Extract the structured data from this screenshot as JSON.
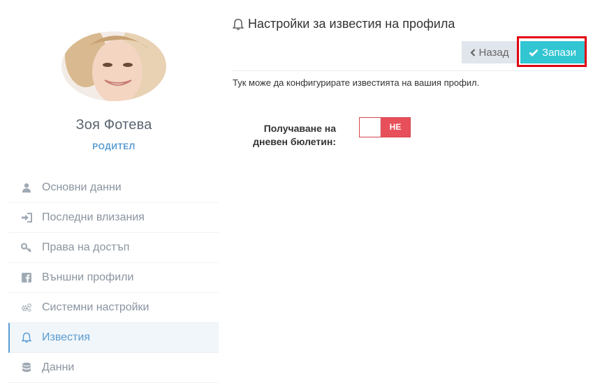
{
  "profile": {
    "name": "Зоя Фотева",
    "role": "РОДИТЕЛ"
  },
  "menu": {
    "items": [
      {
        "label": "Основни данни",
        "icon": "user-icon"
      },
      {
        "label": "Последни влизания",
        "icon": "sign-in-icon"
      },
      {
        "label": "Права на достъп",
        "icon": "key-icon"
      },
      {
        "label": "Външни профили",
        "icon": "facebook-icon"
      },
      {
        "label": "Системни настройки",
        "icon": "cogs-icon"
      },
      {
        "label": "Известия",
        "icon": "bell-icon",
        "active": true
      },
      {
        "label": "Данни",
        "icon": "database-icon"
      }
    ]
  },
  "main": {
    "title": "Настройки за известия на профила",
    "back_label": "Назад",
    "save_label": "Запази",
    "description": "Тук може да конфигурирате известията на вашия профил.",
    "daily_bulletin": {
      "label_line1": "Получаване на",
      "label_line2": "дневен бюлетин:",
      "state_text": "НЕ",
      "enabled": false
    }
  },
  "colors": {
    "accent": "#5b9bd1",
    "save": "#32c5d2",
    "toggle_off": "#e7505a",
    "highlight": "#e2000f"
  }
}
